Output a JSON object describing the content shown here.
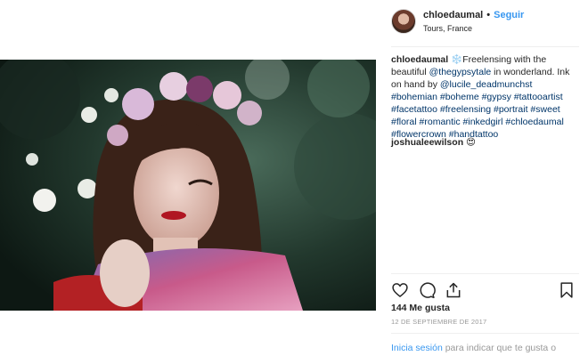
{
  "post": {
    "header": {
      "username": "chloedaumal",
      "separator": "•",
      "follow_label": "Seguir",
      "location": "Tours, France"
    },
    "caption": {
      "username": "chloedaumal",
      "emoji": "❄️",
      "text_1": "Freelensing with the beautiful ",
      "mention_1": "@thegypsytale",
      "text_2": " in wonderland. Ink on hand by ",
      "mention_2": "@lucile_deadmunchst",
      "hashtags": "#bohemian #boheme #gypsy #tattooartist #facetattoo #freelensing #portrait #sweet #floral #romantic #inkedgirl #chloedaumal #flowercrown #handtattoo"
    },
    "comment": {
      "username": "joshualeewilson",
      "emoji": "😍"
    },
    "actions": {
      "like_icon": "heart-icon",
      "comment_icon": "comment-icon",
      "share_icon": "share-icon",
      "save_icon": "bookmark-icon"
    },
    "likes_label": "144 Me gusta",
    "date": "12 DE SEPTIEMBRE DE 2017",
    "login": {
      "link_label": "Inicia sesión",
      "rest_text": " para indicar que te gusta o"
    },
    "photo": {
      "subject": "portrait with flower crown"
    }
  }
}
